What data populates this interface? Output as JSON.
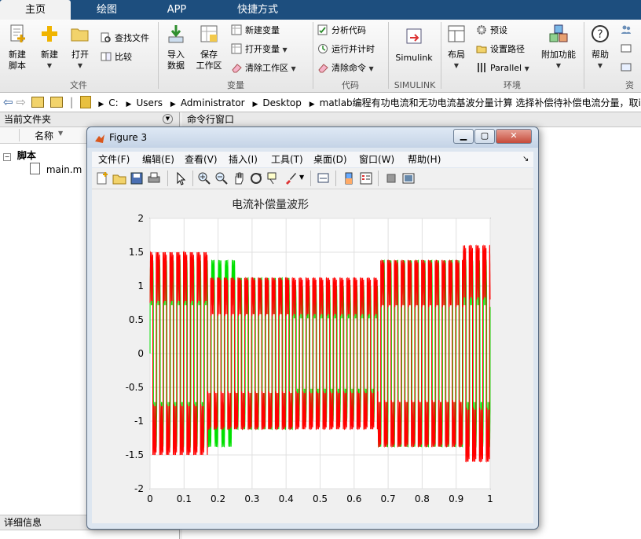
{
  "tabs": [
    "主页",
    "绘图",
    "APP",
    "快捷方式"
  ],
  "ribbon": {
    "file": {
      "new_script": "新建\n脚本",
      "new": "新建",
      "open": "打开",
      "find_files": "查找文件",
      "compare": "比较",
      "group": "文件"
    },
    "variable": {
      "import": "导入\n数据",
      "save_ws": "保存\n工作区",
      "new_var": "新建变量",
      "open_var": "打开变量",
      "clear_ws": "清除工作区",
      "group": "变量"
    },
    "code": {
      "analyze": "分析代码",
      "run_time": "运行并计时",
      "clear_cmd": "清除命令",
      "group": "代码"
    },
    "simulink": {
      "label": "Simulink",
      "group": "SIMULINK"
    },
    "env": {
      "layout": "布局",
      "prefs": "预设",
      "set_path": "设置路径",
      "parallel": "Parallel",
      "addons": "附加功能",
      "group": "环境"
    },
    "resources": {
      "help": "帮助",
      "group": "资"
    }
  },
  "address": {
    "parts": [
      "C:",
      "Users",
      "Administrator",
      "Desktop",
      "matlab编程有功电流和无功电流基波分量计算  选择补偿待补偿电流分量，取ip和"
    ]
  },
  "left_pane": {
    "title": "当前文件夹",
    "col_name": "名称",
    "folder": "脚本",
    "file": "main.m",
    "details": "详细信息"
  },
  "cmd_pane": {
    "title": "命令行窗口"
  },
  "figure": {
    "title": "Figure 3",
    "menus": [
      "文件(F)",
      "编辑(E)",
      "查看(V)",
      "插入(I)",
      "工具(T)",
      "桌面(D)",
      "窗口(W)",
      "帮助(H)"
    ]
  },
  "colors": {
    "series_red": "#ff0000",
    "series_green": "#00e000",
    "tabbar": "#1d4e7e"
  },
  "chart_data": {
    "type": "line",
    "title": "电流补偿量波形",
    "xlabel": "",
    "ylabel": "",
    "xlim": [
      0,
      1
    ],
    "ylim": [
      -2,
      2
    ],
    "xticks": [
      "0",
      "0.1",
      "0.2",
      "0.3",
      "0.4",
      "0.5",
      "0.6",
      "0.7",
      "0.8",
      "0.9",
      "1"
    ],
    "yticks": [
      "2",
      "1.5",
      "1",
      "0.5",
      "0",
      "-0.5",
      "-1",
      "-1.5",
      "-2"
    ],
    "grid": true,
    "series": [
      {
        "color": "#00e000",
        "freq": 50,
        "segments": [
          {
            "x": [
              0,
              0.25
            ],
            "amp": 1.38
          },
          {
            "x": [
              0.25,
              0.42
            ],
            "amp": 1.12
          },
          {
            "x": [
              0.42,
              0.67
            ],
            "amp": 1.0
          },
          {
            "x": [
              0.67,
              1.0
            ],
            "amp": 1.38
          }
        ]
      },
      {
        "color": "#ff0000",
        "freq": 50,
        "segments": [
          {
            "x": [
              0,
              0.17
            ],
            "amp": 1.5
          },
          {
            "x": [
              0.17,
              0.67
            ],
            "amp": 1.12
          },
          {
            "x": [
              0.67,
              0.92
            ],
            "amp": 1.38
          },
          {
            "x": [
              0.92,
              1.0
            ],
            "amp": 1.6
          }
        ]
      }
    ]
  }
}
